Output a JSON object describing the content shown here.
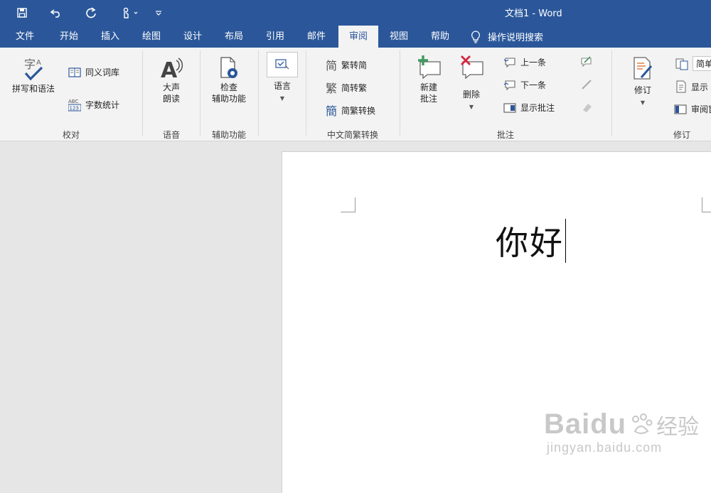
{
  "window": {
    "title": "文档1  -  Word"
  },
  "qat": {
    "save_icon": "save-icon",
    "undo_icon": "undo-icon",
    "redo_icon": "redo-icon",
    "touch_icon": "touch-mode-icon",
    "customize_icon": "customize-qat-icon"
  },
  "tabs": [
    {
      "label": "文件"
    },
    {
      "label": "开始"
    },
    {
      "label": "插入"
    },
    {
      "label": "绘图"
    },
    {
      "label": "设计"
    },
    {
      "label": "布局"
    },
    {
      "label": "引用"
    },
    {
      "label": "邮件"
    },
    {
      "label": "审阅"
    },
    {
      "label": "视图"
    },
    {
      "label": "帮助"
    }
  ],
  "tellme": {
    "label": "操作说明搜索"
  },
  "ribbon": {
    "proofing": {
      "label": "校对",
      "spelling": "拼写和语法",
      "thesaurus": "同义词库",
      "wordcount": "字数统计"
    },
    "speech": {
      "label": "语音",
      "readaloud_1": "大声",
      "readaloud_2": "朗读"
    },
    "accessibility": {
      "label": "辅助功能",
      "check_1": "检查",
      "check_2": "辅助功能"
    },
    "language": {
      "label": "语言"
    },
    "chinese": {
      "label": "中文简繁转换",
      "to_simp": "繁转简",
      "to_trad": "简转繁",
      "convert": "简繁转换"
    },
    "comments": {
      "label": "批注",
      "new_1": "新建",
      "new_2": "批注",
      "delete": "删除",
      "prev": "上一条",
      "next": "下一条",
      "show": "显示批注"
    },
    "tracking": {
      "label": "修订",
      "track": "修订",
      "simple": "简单",
      "show": "显示",
      "pane": "审阅窗"
    }
  },
  "document": {
    "text": "你好"
  },
  "watermark": {
    "brand": "Baidu",
    "cn": "经验",
    "url": "jingyan.baidu.com"
  }
}
